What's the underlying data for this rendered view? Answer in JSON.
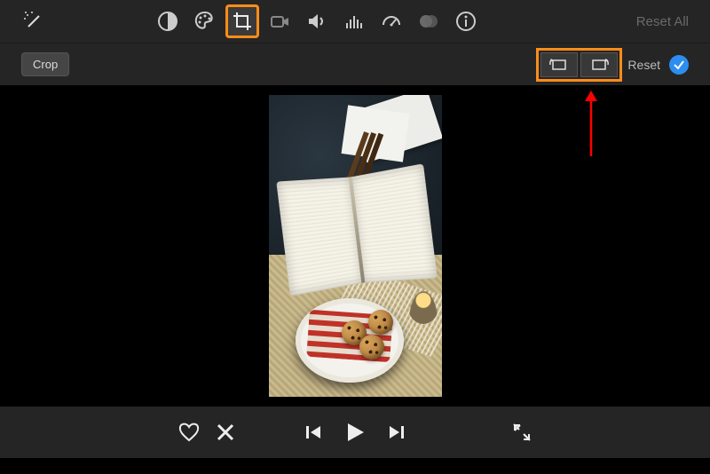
{
  "toolbar": {
    "reset_all_label": "Reset All",
    "icons": {
      "magic": "magic-wand-icon",
      "contrast": "contrast-icon",
      "palette": "palette-icon",
      "crop": "crop-icon",
      "camera": "camera-icon",
      "volume": "volume-icon",
      "eq": "equalizer-icon",
      "speed": "speedometer-icon",
      "overlap": "overlap-circles-icon",
      "info": "info-icon"
    }
  },
  "sub_toolbar": {
    "crop_label": "Crop",
    "reset_label": "Reset",
    "rotate_ccw": "rotate-ccw-icon",
    "rotate_cw": "rotate-cw-icon"
  },
  "playback": {
    "favorite": "heart-icon",
    "reject": "x-icon",
    "prev": "previous-icon",
    "play": "play-icon",
    "next": "next-icon",
    "fullscreen": "fullscreen-icon"
  },
  "annotations": {
    "crop_highlight": true,
    "rotate_highlight": true,
    "arrow_color": "#ff0000"
  }
}
